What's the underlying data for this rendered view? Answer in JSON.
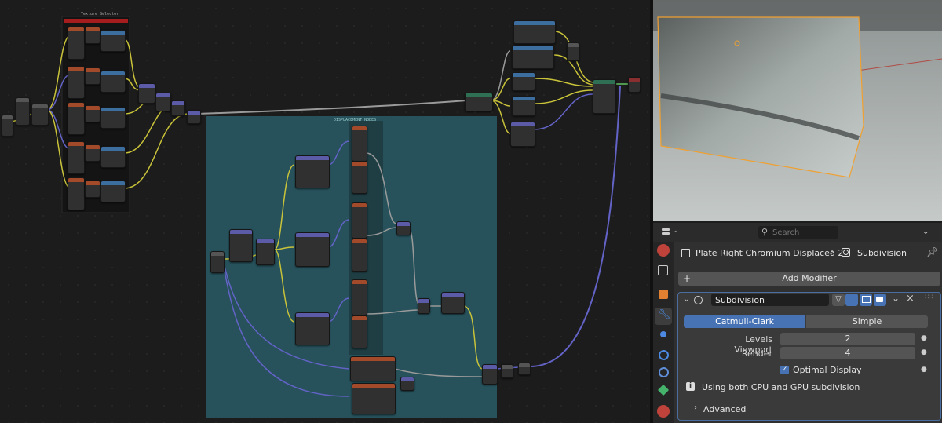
{
  "colors": {
    "accent": "#4772b3",
    "frame_teal": "#27525c",
    "frame_dark": "#1b1b1b",
    "selection_orange": "#f0a030",
    "wire_yellow": "#c9c33a",
    "wire_purple": "#6363c7",
    "wire_gray": "#9a9a9a",
    "wire_green": "#62c462"
  },
  "node_editor": {
    "frame_texture_label": "Texture Selector",
    "frame_group_label": "DISPLACEMENT NODES"
  },
  "properties": {
    "header": {
      "editor_icon": "properties-editor-icon",
      "search_placeholder": "Search"
    },
    "breadcrumb": {
      "object_name": "Plate Right Chromium Displaced 2",
      "separator": "›",
      "modifier_name": "Subdivision"
    },
    "add_modifier_label": "Add Modifier",
    "modifier": {
      "name": "Subdivision",
      "type_options": [
        "Catmull-Clark",
        "Simple"
      ],
      "selected_type": "Catmull-Clark",
      "levels_viewport_label": "Levels Viewport",
      "levels_viewport_value": "2",
      "render_label": "Render",
      "render_value": "4",
      "optimal_display_label": "Optimal Display",
      "optimal_display_checked": true,
      "info_text": "Using both CPU and GPU subdivision",
      "advanced_label": "Advanced"
    }
  }
}
